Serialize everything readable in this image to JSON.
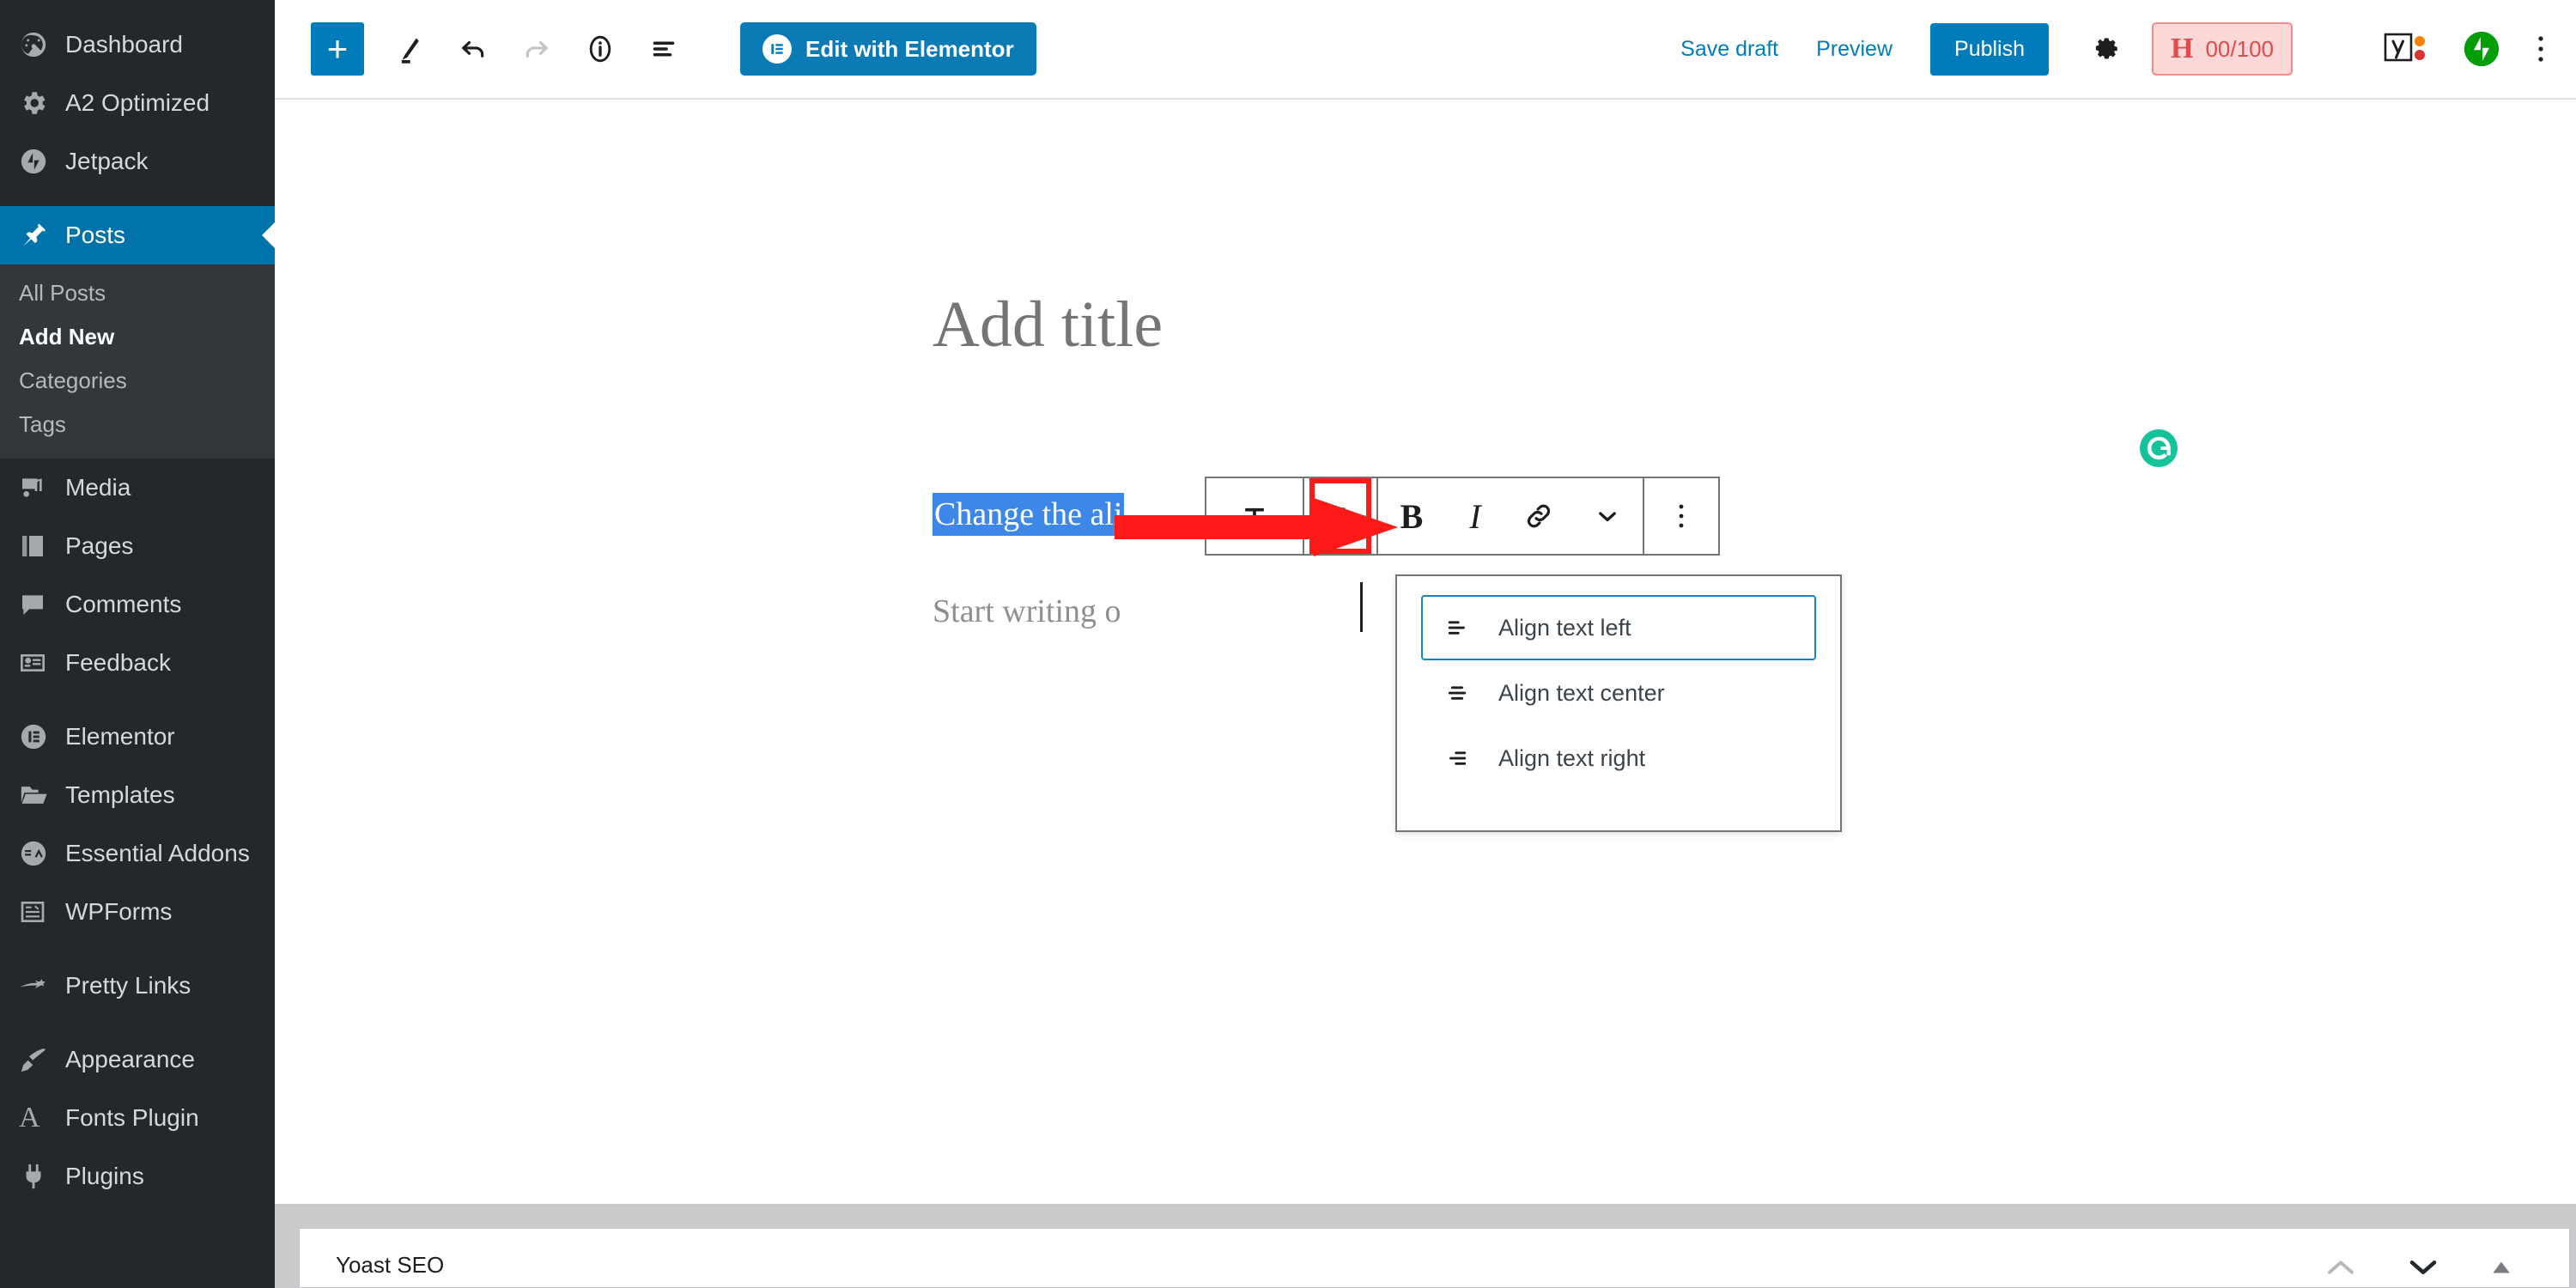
{
  "sidebar": {
    "groups": [
      {
        "items": [
          {
            "label": "Dashboard",
            "icon": "dashboard-icon",
            "active": false
          },
          {
            "label": "A2 Optimized",
            "icon": "gear-icon",
            "active": false
          },
          {
            "label": "Jetpack",
            "icon": "jetpack-icon",
            "active": false
          }
        ]
      },
      {
        "items": [
          {
            "label": "Posts",
            "icon": "pin-icon",
            "active": true
          }
        ],
        "submenu": [
          {
            "label": "All Posts",
            "current": false
          },
          {
            "label": "Add New",
            "current": true
          },
          {
            "label": "Categories",
            "current": false
          },
          {
            "label": "Tags",
            "current": false
          }
        ]
      },
      {
        "items": [
          {
            "label": "Media",
            "icon": "media-icon",
            "active": false
          },
          {
            "label": "Pages",
            "icon": "pages-icon",
            "active": false
          },
          {
            "label": "Comments",
            "icon": "comments-icon",
            "active": false
          },
          {
            "label": "Feedback",
            "icon": "feedback-icon",
            "active": false
          }
        ]
      },
      {
        "items": [
          {
            "label": "Elementor",
            "icon": "elementor-icon",
            "active": false
          },
          {
            "label": "Templates",
            "icon": "folder-icon",
            "active": false
          },
          {
            "label": "Essential Addons",
            "icon": "essential-addons-icon",
            "active": false
          },
          {
            "label": "WPForms",
            "icon": "wpforms-icon",
            "active": false
          }
        ]
      },
      {
        "items": [
          {
            "label": "Pretty Links",
            "icon": "pretty-links-icon",
            "active": false
          }
        ]
      },
      {
        "items": [
          {
            "label": "Appearance",
            "icon": "brush-icon",
            "active": false
          },
          {
            "label": "Fonts Plugin",
            "icon": "letter-a-icon",
            "active": false
          },
          {
            "label": "Plugins",
            "icon": "plug-icon",
            "active": false
          }
        ]
      }
    ]
  },
  "header": {
    "add_block_label": "+",
    "tools": [
      {
        "name": "add-block-button",
        "label": "+"
      },
      {
        "name": "tools-pen-button",
        "label": ""
      },
      {
        "name": "undo-button",
        "label": ""
      },
      {
        "name": "redo-button",
        "label": ""
      },
      {
        "name": "details-info-button",
        "label": ""
      },
      {
        "name": "list-view-button",
        "label": ""
      }
    ],
    "elementor_button": "Edit with Elementor",
    "save_draft": "Save draft",
    "preview": "Preview",
    "publish": "Publish",
    "hemingway": {
      "letter": "H",
      "score": "00/100"
    }
  },
  "editor": {
    "title_placeholder": "Add title",
    "selected_text": "Change the ali",
    "empty_paragraph_placeholder": "Start writing o"
  },
  "block_toolbar": {
    "buttons": [
      {
        "name": "block-type-paragraph-button",
        "label": ""
      },
      {
        "name": "align-text-button",
        "label": ""
      },
      {
        "name": "bold-button",
        "label": "B"
      },
      {
        "name": "italic-button",
        "label": "I"
      },
      {
        "name": "link-button",
        "label": ""
      },
      {
        "name": "more-formatting-chevron-button",
        "label": ""
      },
      {
        "name": "block-options-button",
        "label": ""
      }
    ]
  },
  "align_dropdown": {
    "items": [
      {
        "label": "Align text left",
        "icon": "align-left-icon",
        "selected": true
      },
      {
        "label": "Align text center",
        "icon": "align-center-icon",
        "selected": false
      },
      {
        "label": "Align text right",
        "icon": "align-right-icon",
        "selected": false
      }
    ]
  },
  "bottom_panel": {
    "title": "Yoast SEO"
  },
  "colors": {
    "sidebar_bg": "#23282d",
    "sidebar_submenu_bg": "#32373c",
    "accent_blue": "#007cba",
    "active_item_blue": "#0073aa",
    "selection_blue": "#3d87e8",
    "annotation_red": "#ff1a1a",
    "hemingway_red": "#e04c4c",
    "grammarly_green": "#15c39a",
    "jetpack_green": "#069e08"
  }
}
